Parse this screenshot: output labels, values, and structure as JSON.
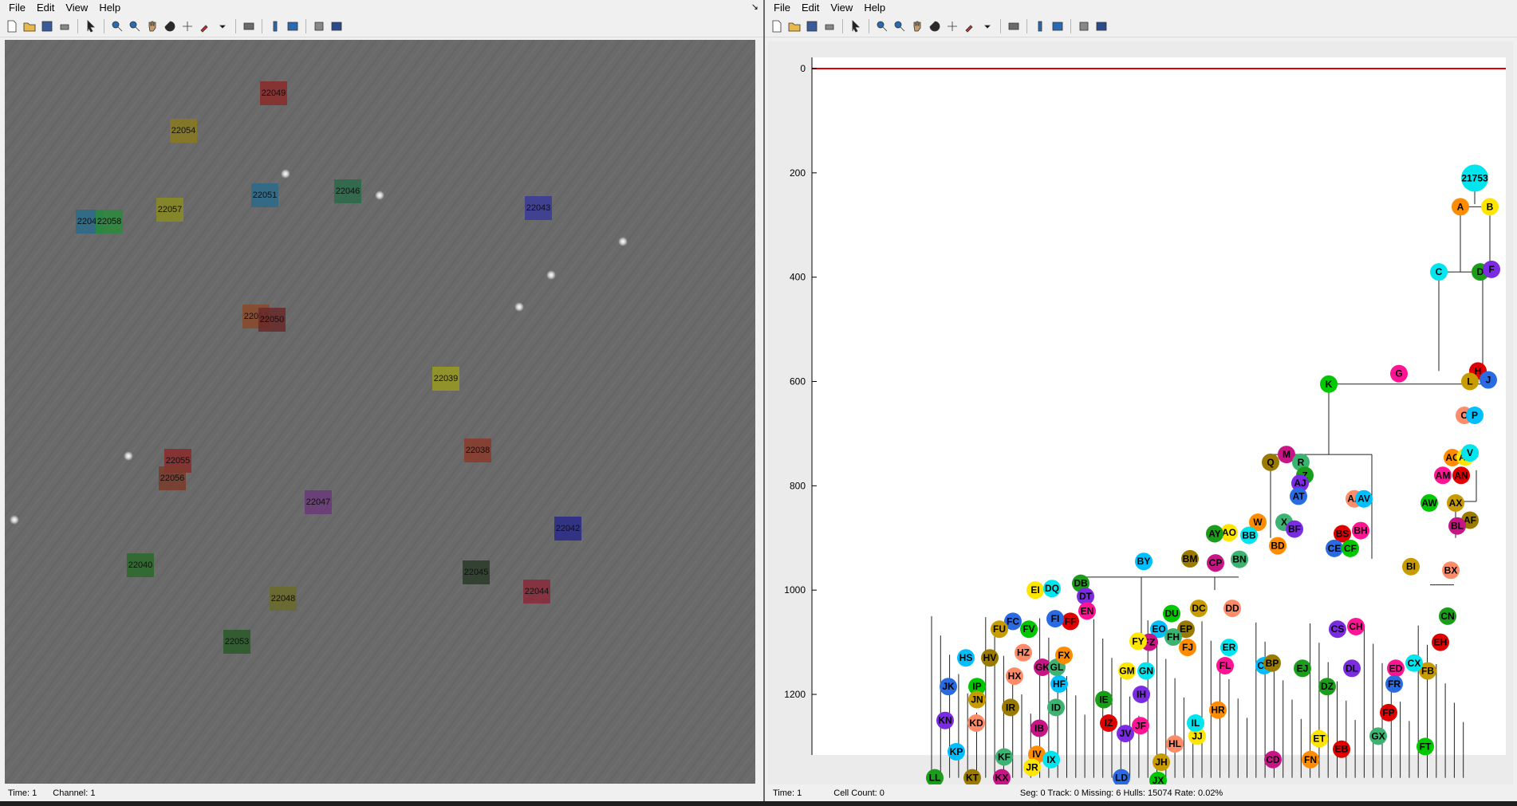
{
  "left_window": {
    "menu": [
      "File",
      "Edit",
      "View",
      "Help"
    ],
    "corner_symbol": "↘",
    "status": {
      "time": "Time: 1",
      "channel": "Channel: 1"
    },
    "cells": [
      {
        "id": "22049",
        "color": "#8a2a2a"
      },
      {
        "id": "22054",
        "color": "#8a7a20"
      },
      {
        "id": "22051",
        "color": "#2a6a8a"
      },
      {
        "id": "22046",
        "color": "#2a6a4a"
      },
      {
        "id": "22041",
        "color": "#2a6a8a"
      },
      {
        "id": "22058",
        "color": "#2a8a3a"
      },
      {
        "id": "22057",
        "color": "#8a8a20"
      },
      {
        "id": "22043",
        "color": "#3a3a9a"
      },
      {
        "id": "22052",
        "color": "#8a4a2a"
      },
      {
        "id": "22050",
        "color": "#6a2a2a"
      },
      {
        "id": "22039",
        "color": "#9a9a20"
      },
      {
        "id": "22038",
        "color": "#8a3a2a"
      },
      {
        "id": "22055",
        "color": "#8a2a2a"
      },
      {
        "id": "22056",
        "color": "#7a3a2a"
      },
      {
        "id": "22047",
        "color": "#6a3a7a"
      },
      {
        "id": "22042",
        "color": "#2a2a8a"
      },
      {
        "id": "22040",
        "color": "#2a6a2a"
      },
      {
        "id": "22045",
        "color": "#2a3a2a"
      },
      {
        "id": "22048",
        "color": "#6a6a2a"
      },
      {
        "id": "22044",
        "color": "#8a2a3a"
      },
      {
        "id": "22053",
        "color": "#2a5a2a"
      }
    ]
  },
  "right_window": {
    "menu": [
      "File",
      "Edit",
      "View",
      "Help"
    ],
    "status": {
      "time": "Time: 1",
      "cell_count": "Cell Count: 0",
      "info": "Seg: 0 Track: 0 Missing: 6 Hulls: 15074 Rate: 0.02%"
    },
    "root_label": "21753",
    "y_axis_ticks": [
      "0",
      "200",
      "400",
      "600",
      "800",
      "1000",
      "1200"
    ],
    "nodes": [
      "A",
      "B",
      "C",
      "D",
      "F",
      "G",
      "H",
      "J",
      "K",
      "L",
      "O",
      "P",
      "Q",
      "M",
      "R",
      "AC",
      "AL",
      "V",
      "Z",
      "AJ",
      "AM",
      "AN",
      "AT",
      "AW",
      "AX",
      "AA",
      "AV",
      "AF",
      "BL",
      "X",
      "W",
      "AO",
      "BB",
      "AY",
      "BF",
      "BH",
      "BS",
      "CE",
      "CF",
      "BI",
      "BX",
      "BY",
      "BM",
      "CP",
      "BN",
      "BD",
      "EI",
      "DQ",
      "DB",
      "DT",
      "EN",
      "FF",
      "FI",
      "DU",
      "DC",
      "DD",
      "EO",
      "EP",
      "FZ",
      "FH",
      "FJ",
      "FY",
      "ER",
      "CN",
      "CS",
      "CH",
      "EH",
      "FC",
      "FV",
      "FU",
      "HZ",
      "HS",
      "HV",
      "GK",
      "GL",
      "FX",
      "GM",
      "GN",
      "IE",
      "IH",
      "FL",
      "FP",
      "JK",
      "IP",
      "JN",
      "HX",
      "HF",
      "IR",
      "IB",
      "ID",
      "HR",
      "JJ",
      "IL",
      "DZ",
      "DL",
      "ED",
      "EB",
      "FR",
      "FT",
      "FB",
      "KD",
      "KP",
      "KT",
      "KX",
      "KF",
      "IV",
      "JR",
      "IX",
      "LL",
      "JV",
      "JF",
      "IZ",
      "LD",
      "JX",
      "JH",
      "HL",
      "CB",
      "BP",
      "CD",
      "GX",
      "FN",
      "ET",
      "CX",
      "EJ",
      "KN"
    ]
  }
}
